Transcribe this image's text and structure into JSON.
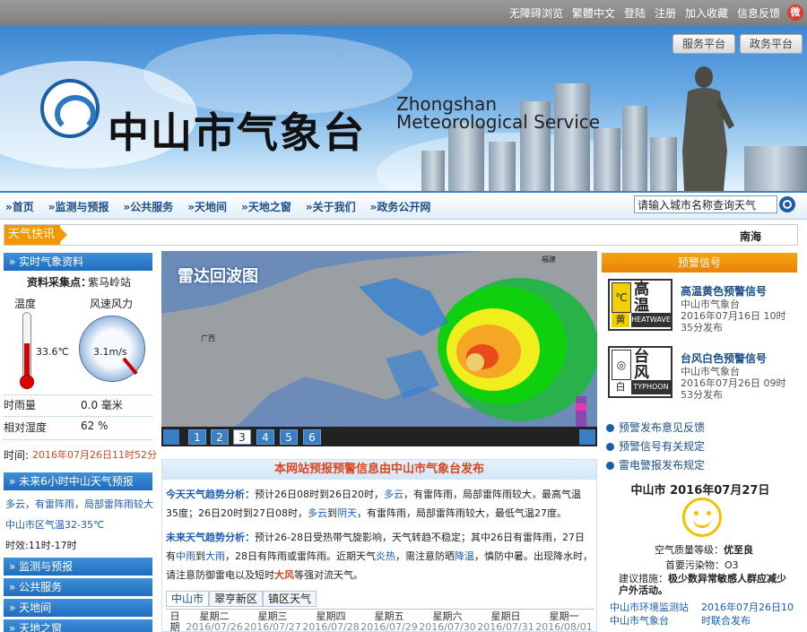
{
  "topbar": {
    "links": [
      "无障碍浏览",
      "繁體中文",
      "登陆",
      "注册",
      "加入收藏",
      "信息反馈"
    ],
    "weibo": "微"
  },
  "header": {
    "title_cn": "中山市气象台",
    "title_en_1": "Zhongshan",
    "title_en_2": "Meteorological Service",
    "btn_service": "服务平台",
    "btn_gov": "政务平台"
  },
  "nav": {
    "items": [
      "»首页",
      "»监测与预报",
      "»公共服务",
      "»天地间",
      "»天地之窗",
      "»关于我们",
      "»政务公开网"
    ],
    "search_value": "请输入城市名称查询天气"
  },
  "ticker": {
    "label": "天气快讯",
    "text": "南海"
  },
  "realtime": {
    "title": "» 实时气象资料",
    "station_label": "资料采集点：",
    "station": "紫马岭站",
    "temp_label": "温度",
    "temp_value": "33.6℃",
    "temp_fraction": 0.64,
    "wind_label": "风速风力",
    "wind_value": "3.1m/s",
    "rain_label": "时雨量",
    "rain_value": "0.0 毫米",
    "humid_label": "相对湿度",
    "humid_value": "62 %",
    "time_label": "时间:",
    "time_value": "2016年07月26日11时52分"
  },
  "next6h": {
    "title": "» 未来6小时中山天气预报",
    "line1": "多云，有雷阵雨，局部雷阵雨较大",
    "line2": "中山市区气温32-35℃",
    "line3": "时效:11时-17时"
  },
  "leftmenu": [
    "» 监测与预报",
    "» 公共服务",
    "» 天地间",
    "» 天地之窗"
  ],
  "radar": {
    "title": "雷达回波图",
    "tabs": [
      "1",
      "2",
      "3",
      "4",
      "5",
      "6"
    ],
    "active": 2,
    "labels": {
      "fujian": "福建",
      "guangxi": "广西"
    }
  },
  "forecast": {
    "head": "本网站预报预警信息由中山市气象台发布",
    "today_label": "今天天气趋势分析：",
    "today_a": "预计26日08时到26日20时，",
    "today_b": "多云",
    "today_c": "，有雷阵雨，局部雷阵雨较大，最高气温35度；26日20时到27日08时，",
    "today_d": "多云",
    "today_e": "到",
    "today_f": "阴天",
    "today_g": "，有雷阵雨，局部雷阵雨较大，最低气温27度。",
    "future_label": "未来天气趋势分析：",
    "future_a": "预计26-28日受热带气旋影响，天气转趋不稳定；其中26日有雷阵雨，27日有",
    "future_b": "中雨",
    "future_c": "到",
    "future_d": "大雨",
    "future_e": "，28日有阵雨或雷阵雨。近期天气",
    "future_f": "炎热",
    "future_g": "，需注意防晒",
    "future_h": "降温",
    "future_i": "，慎防中暑。",
    "future_j": "出现降水时，请注意防御雷电以及短时",
    "future_k": "大风",
    "future_l": "等强对流天气。",
    "tabs": [
      "中山市",
      "翠亨新区",
      "镇区天气"
    ],
    "table_head": "日期",
    "days": [
      {
        "w": "星期二",
        "d": "2016/07/26"
      },
      {
        "w": "星期三",
        "d": "2016/07/27"
      },
      {
        "w": "星期四",
        "d": "2016/07/28"
      },
      {
        "w": "星期五",
        "d": "2016/07/29"
      },
      {
        "w": "星期六",
        "d": "2016/07/30"
      },
      {
        "w": "星期日",
        "d": "2016/07/31"
      },
      {
        "w": "星期一",
        "d": "2016/08/01"
      }
    ]
  },
  "warnings": {
    "title": "预警信号",
    "items": [
      {
        "sym": "℃",
        "big1": "高",
        "big2": "温",
        "lab": "黄",
        "en": "HEATWAVE",
        "name": "高温黄色预警信号",
        "org": "中山市气象台",
        "time": "2016年07月16日 10时35分发布"
      },
      {
        "sym": "◎",
        "big1": "台",
        "big2": "风",
        "lab": "白",
        "en": "TYPHOON",
        "name": "台风白色预警信号",
        "org": "中山市气象台",
        "time": "2016年07月26日 09时53分发布"
      }
    ],
    "links": [
      "预警发布意见反馈",
      "预警信号有关规定",
      "雷电警报发布规定"
    ]
  },
  "aq": {
    "date": "中山市  2016年07月27日",
    "level_label": "空气质量等级：",
    "level": "优至良",
    "pollutant_label": "首要污染物：",
    "pollutant": "O3",
    "advice_label": "建议措施：",
    "advice": "极少数异常敏感人群应减少户外活动。",
    "src1": "中山市环境监测站",
    "src2": "中山市气象台",
    "pub": "2016年07月26日10时联合发布"
  },
  "colors": {
    "accent": "#1f6dbd",
    "orange": "#f39800",
    "alert": "#d9461f"
  }
}
